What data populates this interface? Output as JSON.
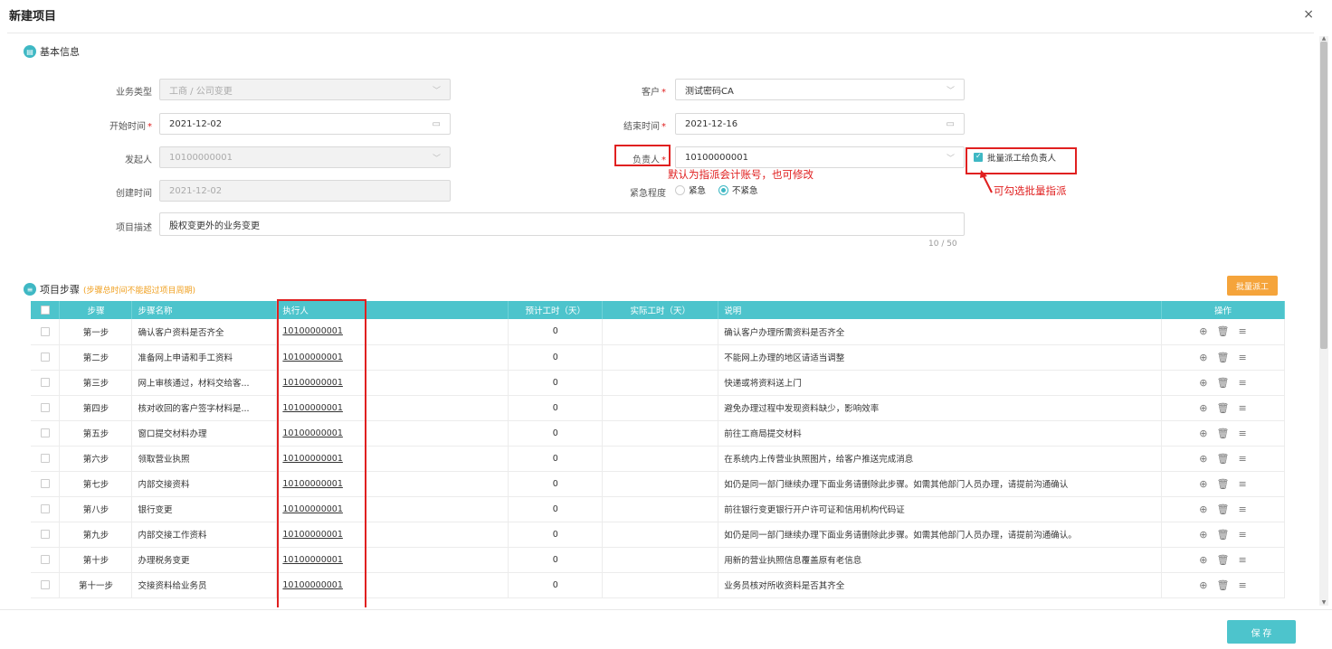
{
  "dialog": {
    "title": "新建项目",
    "close": "×"
  },
  "basic": {
    "section_title": "基本信息",
    "business_type": {
      "label": "业务类型",
      "value": "工商 / 公司变更"
    },
    "customer": {
      "label": "客户",
      "required": "*",
      "value": "测试密码CA"
    },
    "start_time": {
      "label": "开始时间",
      "required": "*",
      "value": "2021-12-02"
    },
    "end_time": {
      "label": "结束时间",
      "required": "*",
      "value": "2021-12-16"
    },
    "initiator": {
      "label": "发起人",
      "value": "10100000001"
    },
    "owner": {
      "label": "负责人",
      "required": "*",
      "value": "10100000001"
    },
    "batch_assign_owner": {
      "label": "批量派工给负责人",
      "checked": true
    },
    "created_time": {
      "label": "创建时间",
      "value": "2021-12-02"
    },
    "urgency": {
      "label": "紧急程度",
      "options": [
        "紧急",
        "不紧急"
      ],
      "selected": "不紧急"
    },
    "description": {
      "label": "项目描述",
      "value": "股权变更外的业务变更",
      "counter": "10 / 50"
    }
  },
  "annotations": {
    "owner_note": "默认为指派会计账号，也可修改",
    "batch_note": "可勾选批量指派"
  },
  "steps": {
    "section_title": "项目步骤",
    "section_note": "(步骤总时间不能超过项目周期)",
    "batch_button": "批量派工",
    "columns": [
      "步骤",
      "步骤名称",
      "执行人",
      "预计工时（天）",
      "实际工时（天）",
      "说明",
      "操作"
    ],
    "rows": [
      {
        "step": "第一步",
        "name": "确认客户资料是否齐全",
        "executor": "10100000001",
        "est": "0",
        "actual": "",
        "desc": "确认客户办理所需资料是否齐全"
      },
      {
        "step": "第二步",
        "name": "准备网上申请和手工资料",
        "executor": "10100000001",
        "est": "0",
        "actual": "",
        "desc": "不能网上办理的地区请适当调整"
      },
      {
        "step": "第三步",
        "name": "网上审核通过，材料交给客...",
        "executor": "10100000001",
        "est": "0",
        "actual": "",
        "desc": "快递或将资料送上门"
      },
      {
        "step": "第四步",
        "name": "核对收回的客户签字材料是...",
        "executor": "10100000001",
        "est": "0",
        "actual": "",
        "desc": "避免办理过程中发现资料缺少，影响效率"
      },
      {
        "step": "第五步",
        "name": "窗口提交材料办理",
        "executor": "10100000001",
        "est": "0",
        "actual": "",
        "desc": "前往工商局提交材料"
      },
      {
        "step": "第六步",
        "name": "领取营业执照",
        "executor": "10100000001",
        "est": "0",
        "actual": "",
        "desc": "在系统内上传营业执照图片，给客户推送完成消息"
      },
      {
        "step": "第七步",
        "name": "内部交接资料",
        "executor": "10100000001",
        "est": "0",
        "actual": "",
        "desc": "如仍是同一部门继续办理下面业务请删除此步骤。如需其他部门人员办理，请提前沟通确认"
      },
      {
        "step": "第八步",
        "name": "银行变更",
        "executor": "10100000001",
        "est": "0",
        "actual": "",
        "desc": "前往银行变更银行开户许可证和信用机构代码证"
      },
      {
        "step": "第九步",
        "name": "内部交接工作资料",
        "executor": "10100000001",
        "est": "0",
        "actual": "",
        "desc": "如仍是同一部门继续办理下面业务请删除此步骤。如需其他部门人员办理，请提前沟通确认。"
      },
      {
        "step": "第十步",
        "name": "办理税务变更",
        "executor": "10100000001",
        "est": "0",
        "actual": "",
        "desc": "用新的营业执照信息覆盖原有老信息"
      },
      {
        "step": "第十一步",
        "name": "交接资料给业务员",
        "executor": "10100000001",
        "est": "0",
        "actual": "",
        "desc": "业务员核对所收资料是否其齐全"
      }
    ]
  },
  "footer": {
    "save": "保 存"
  }
}
